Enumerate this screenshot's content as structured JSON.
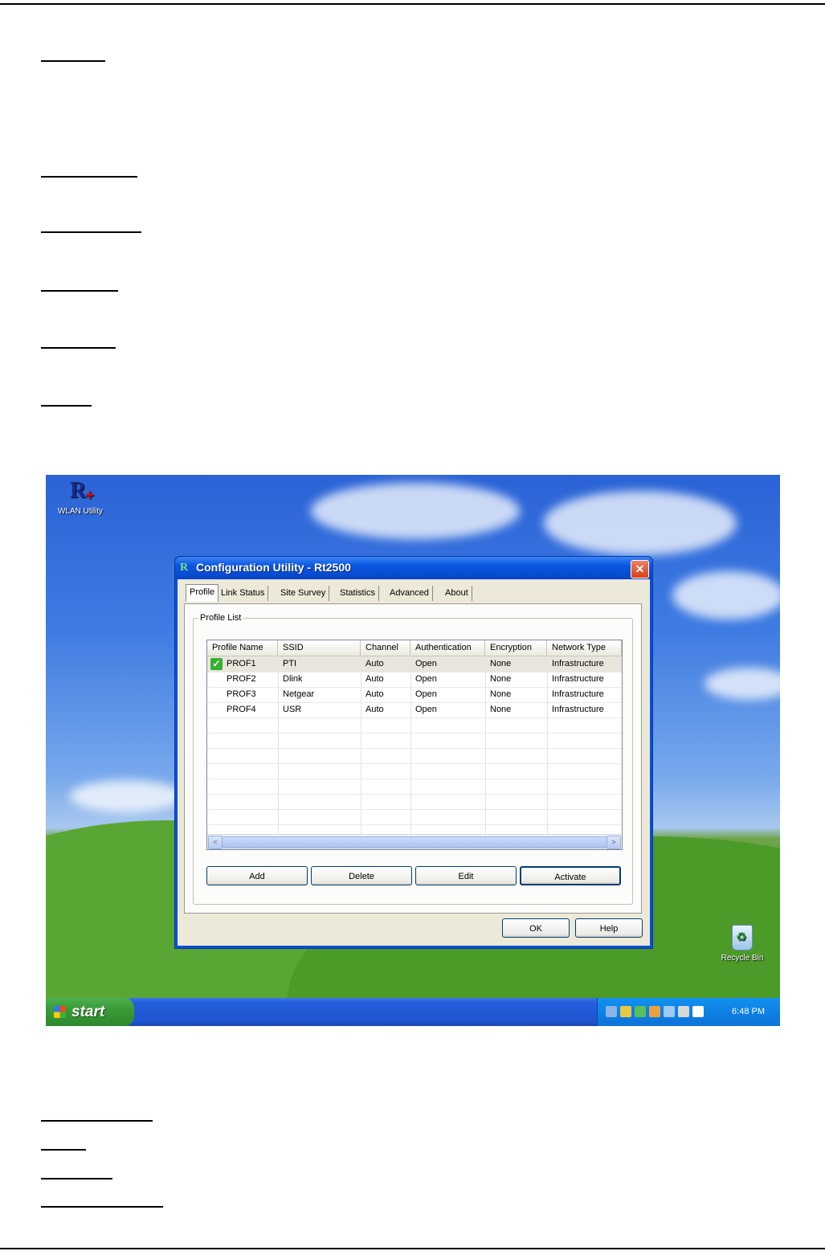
{
  "desktop": {
    "icons": {
      "wlan_utility": "WLAN Utility",
      "recycle_bin": "Recycle Bin"
    }
  },
  "window": {
    "title": "Configuration Utility - Rt2500",
    "close": "✕",
    "tabs": [
      "Profile",
      "Link Status",
      "Site Survey",
      "Statistics",
      "Advanced",
      "About"
    ],
    "active_tab": "Profile",
    "group_label": "Profile List",
    "columns": [
      "Profile Name",
      "SSID",
      "Channel",
      "Authentication",
      "Encryption",
      "Network Type"
    ],
    "rows": [
      [
        "PROF1",
        "PTI",
        "Auto",
        "Open",
        "None",
        "Infrastructure"
      ],
      [
        "PROF2",
        "Dlink",
        "Auto",
        "Open",
        "None",
        "Infrastructure"
      ],
      [
        "PROF3",
        "Netgear",
        "Auto",
        "Open",
        "None",
        "Infrastructure"
      ],
      [
        "PROF4",
        "USR",
        "Auto",
        "Open",
        "None",
        "Infrastructure"
      ]
    ],
    "active_profile_icon": "check-icon",
    "scroll_left": "<",
    "scroll_right": ">",
    "buttons": {
      "add": "Add",
      "delete": "Delete",
      "edit": "Edit",
      "activate": "Activate",
      "ok": "OK",
      "help": "Help"
    }
  },
  "taskbar": {
    "start": "start",
    "clock": "6:48 PM"
  },
  "colors": {
    "titlebar": "#0a55e0",
    "taskbar": "#245edb",
    "start": "#3a9a38",
    "tray": "#0c72d8"
  }
}
